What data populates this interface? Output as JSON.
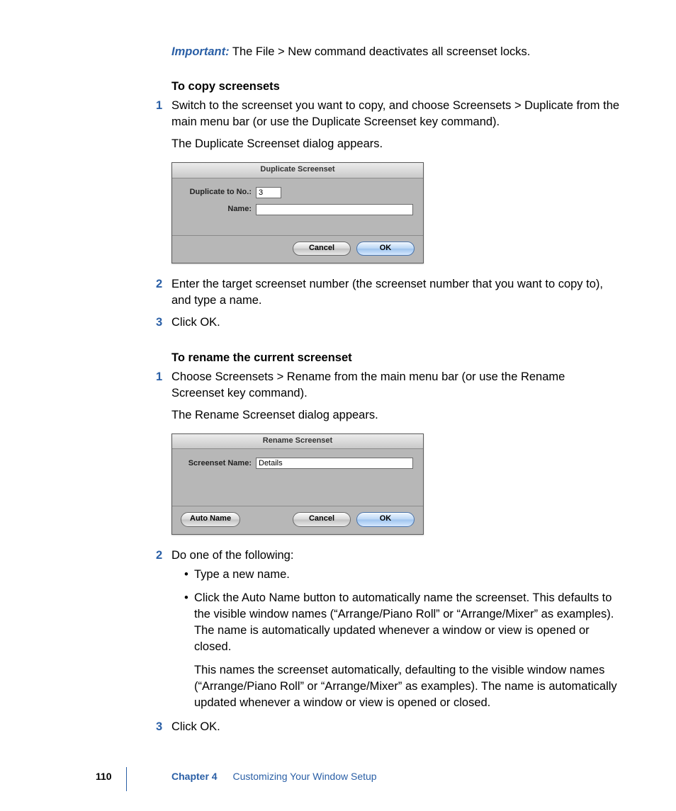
{
  "important": {
    "label": "Important:",
    "text": "The File > New command deactivates all screenset locks."
  },
  "sectionA": {
    "heading": "To copy screensets",
    "steps": {
      "1": "Switch to the screenset you want to copy, and choose Screensets > Duplicate from the main menu bar (or use the Duplicate Screenset key command).",
      "1_follow": "The Duplicate Screenset dialog appears.",
      "2": "Enter the target screenset number (the screenset number that you want to copy to), and type a name.",
      "3": "Click OK."
    }
  },
  "dialogDuplicate": {
    "title": "Duplicate Screenset",
    "label_no": "Duplicate to No.:",
    "value_no": "3",
    "label_name": "Name:",
    "value_name": "",
    "cancel": "Cancel",
    "ok": "OK"
  },
  "sectionB": {
    "heading": "To rename the current screenset",
    "steps": {
      "1": "Choose Screensets > Rename from the main menu bar (or use the Rename Screenset key command).",
      "1_follow": "The Rename Screenset dialog appears.",
      "2": "Do one of the following:",
      "3": "Click OK."
    },
    "bullets": {
      "a": "Type a new name.",
      "b": "Click the Auto Name button to automatically name the screenset. This defaults to the visible window names (“Arrange/Piano Roll” or “Arrange/Mixer” as examples). The name is automatically updated whenever a window or view is opened or closed.",
      "b_follow": "This names the screenset automatically, defaulting to the visible window names (“Arrange/Piano Roll” or “Arrange/Mixer” as examples). The name is automatically updated whenever a window or view is opened or closed."
    }
  },
  "dialogRename": {
    "title": "Rename Screenset",
    "label_name": "Screenset Name:",
    "value_name": "Details",
    "autoname": "Auto Name",
    "cancel": "Cancel",
    "ok": "OK"
  },
  "footer": {
    "page": "110",
    "chapter_label": "Chapter 4",
    "chapter_title": "Customizing Your Window Setup"
  }
}
